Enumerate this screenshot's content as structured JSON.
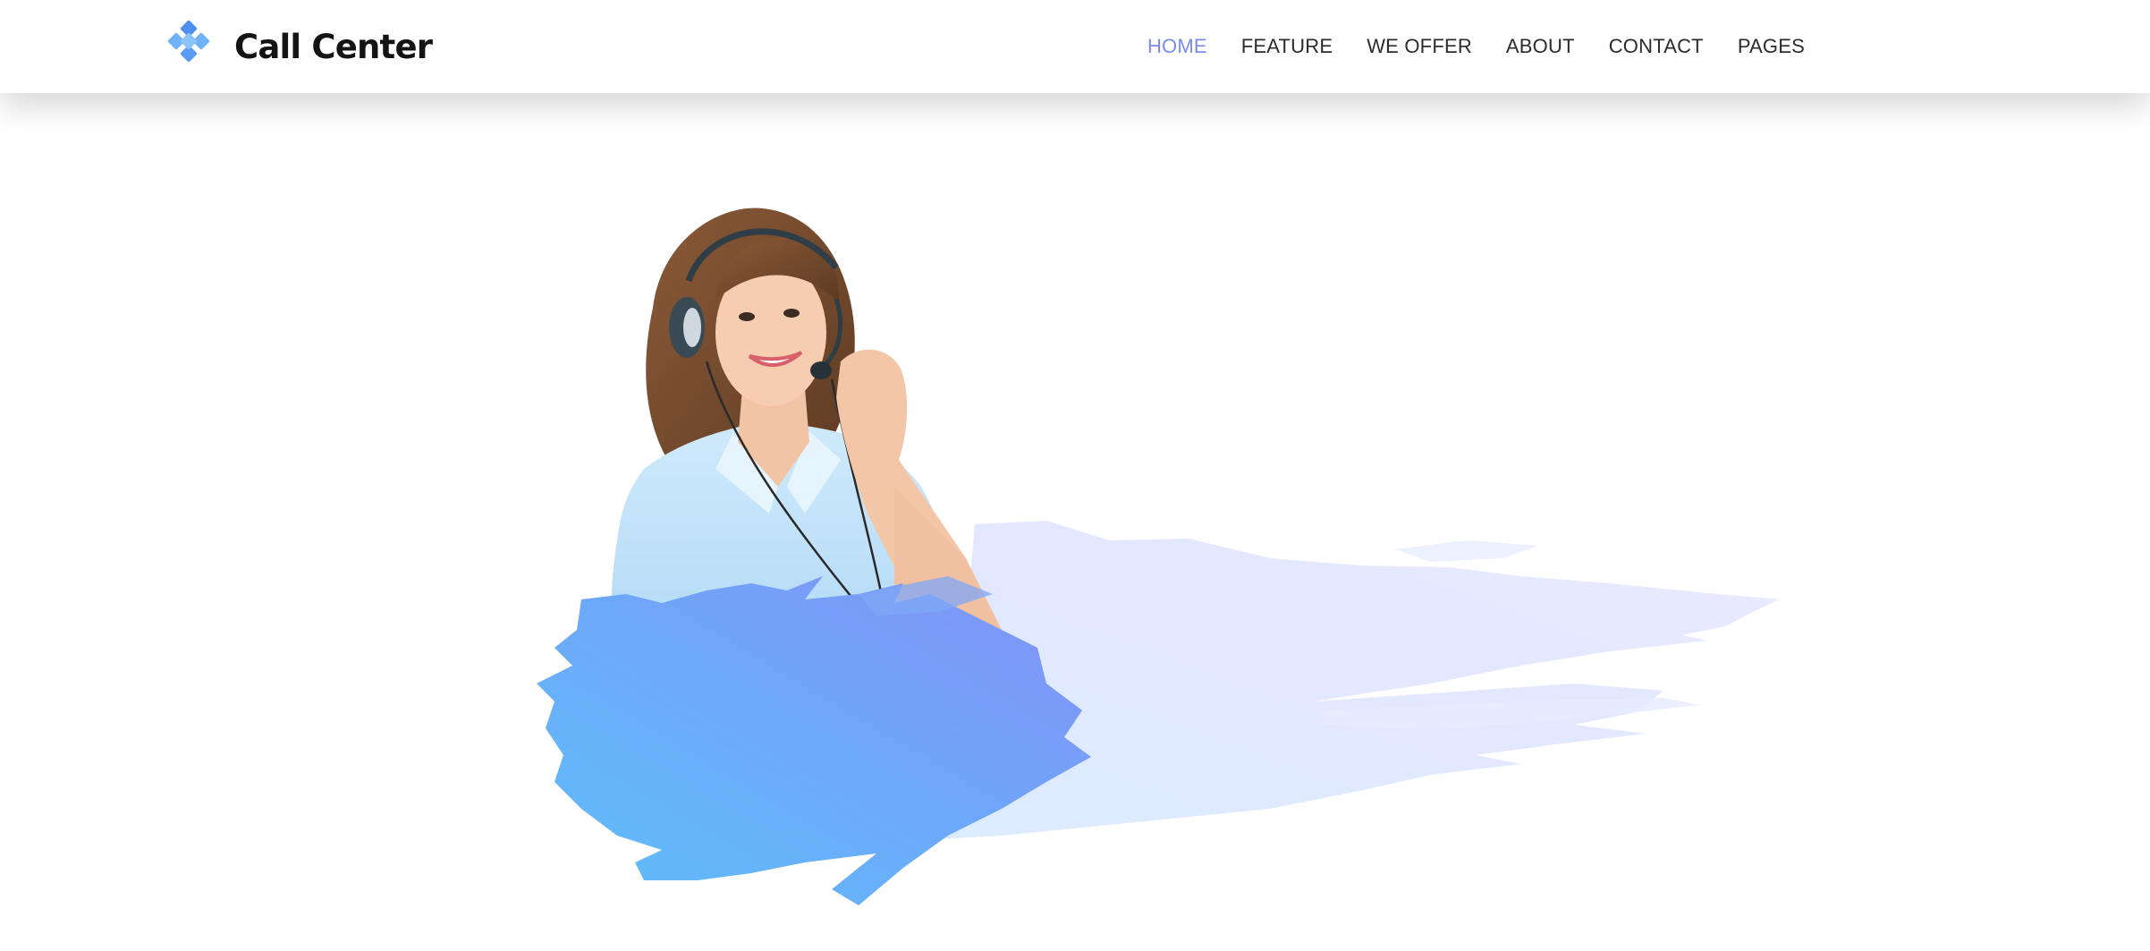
{
  "brand": {
    "name": "Call Center",
    "icon": "diamond-cluster-icon",
    "icon_color": "#5fa5f7"
  },
  "nav": {
    "items": [
      {
        "label": "HOME",
        "active": true
      },
      {
        "label": "FEATURE",
        "active": false
      },
      {
        "label": "WE OFFER",
        "active": false
      },
      {
        "label": "ABOUT",
        "active": false
      },
      {
        "label": "CONTACT",
        "active": false
      },
      {
        "label": "PAGES",
        "active": false
      }
    ],
    "active_color": "#7b8cf0"
  },
  "hero": {
    "image": "call-center-agent-with-headset",
    "brush_colors": [
      "#5fb8f9",
      "#8294f6",
      "#e6ecff"
    ]
  }
}
